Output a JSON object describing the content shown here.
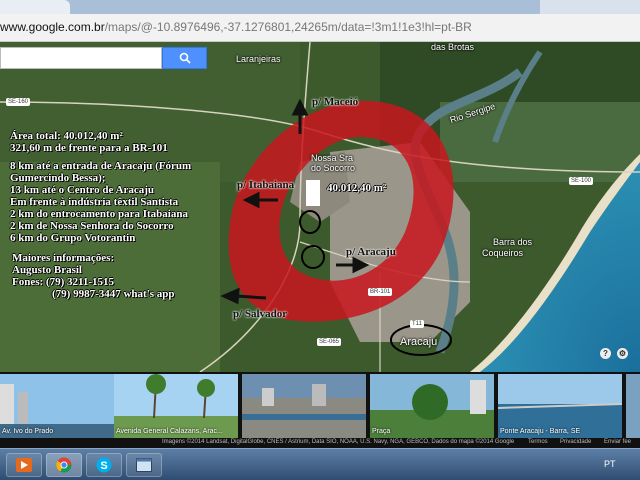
{
  "browser": {
    "url_host": "www.google.com.br",
    "url_path": "/maps/@-10.8976496,-37.1276801,24265m/data=!3m1!1e3!hl=pt-BR"
  },
  "map": {
    "search": {
      "placeholder": "",
      "button_icon": "search-icon"
    },
    "place_labels": {
      "laranjeiras": "Laranjeiras",
      "das_brotas": "das Brotas",
      "rio_sergipe": "Rio Sergipe",
      "nossa_sra": "Nossa Sra",
      "do_socorro": "do Socorro",
      "barra_dos": "Barra dos",
      "coqueiros": "Coqueiros",
      "aracaju": "Aracaju"
    },
    "road_labels": {
      "se160": "SE-160",
      "se100": "SE-100",
      "br101": "BR-101",
      "se065": "SE-065",
      "t11": "T11"
    }
  },
  "overlay": {
    "area_total": "Área total: 40.012,40 m²",
    "frente": "321,60 m de frente para a BR-101",
    "info_lines": [
      "8 km até a entrada de Aracaju (Fórum",
      "Gumercindo Bessa);",
      "13 km até o Centro de Aracaju",
      "Em frente à indústria têxtil Santista",
      "2 km do entrocamento para Itabaiana",
      "2 km de Nossa Senhora do Socorro",
      "6 km do Grupo Votorantin"
    ],
    "contact_title": "Maiores informações:",
    "contact_name": "Augusto Brasil",
    "phone1": "Fones: (79) 3211-1515",
    "phone2": "(79) 9987-3447 what's app",
    "area_tag": "40.012,40 m²",
    "arrows": {
      "maceio": "p/ Maceió",
      "itabaiana": "p/ Itabaiana",
      "aracaju": "p/ Aracaju",
      "salvador": "p/ Salvador"
    }
  },
  "photos": [
    {
      "caption": "Av. Ivo do Prado"
    },
    {
      "caption": "Avenida General Calazans, Arac..."
    },
    {
      "caption": ""
    },
    {
      "caption": "Praça"
    },
    {
      "caption": "Ponte Aracaju - Barra, SE"
    }
  ],
  "attribution": {
    "imagery": "Imagens ©2014 Landsat, DigitalGlobe, CNES / Astrium, Data SIO, NOAA, U.S. Navy, NGA, GEBCO, Dados do mapa ©2014 Google",
    "terms": "Termos",
    "privacy": "Privacidade",
    "feedback": "Enviar fee"
  },
  "taskbar": {
    "language": "PT",
    "apps": [
      "media-player-icon",
      "chrome-icon",
      "skype-icon",
      "window-icon"
    ]
  },
  "colors": {
    "highlight_ring": "#c8161d",
    "search_button": "#4d90fe",
    "ocean": "#2a7fa8"
  }
}
